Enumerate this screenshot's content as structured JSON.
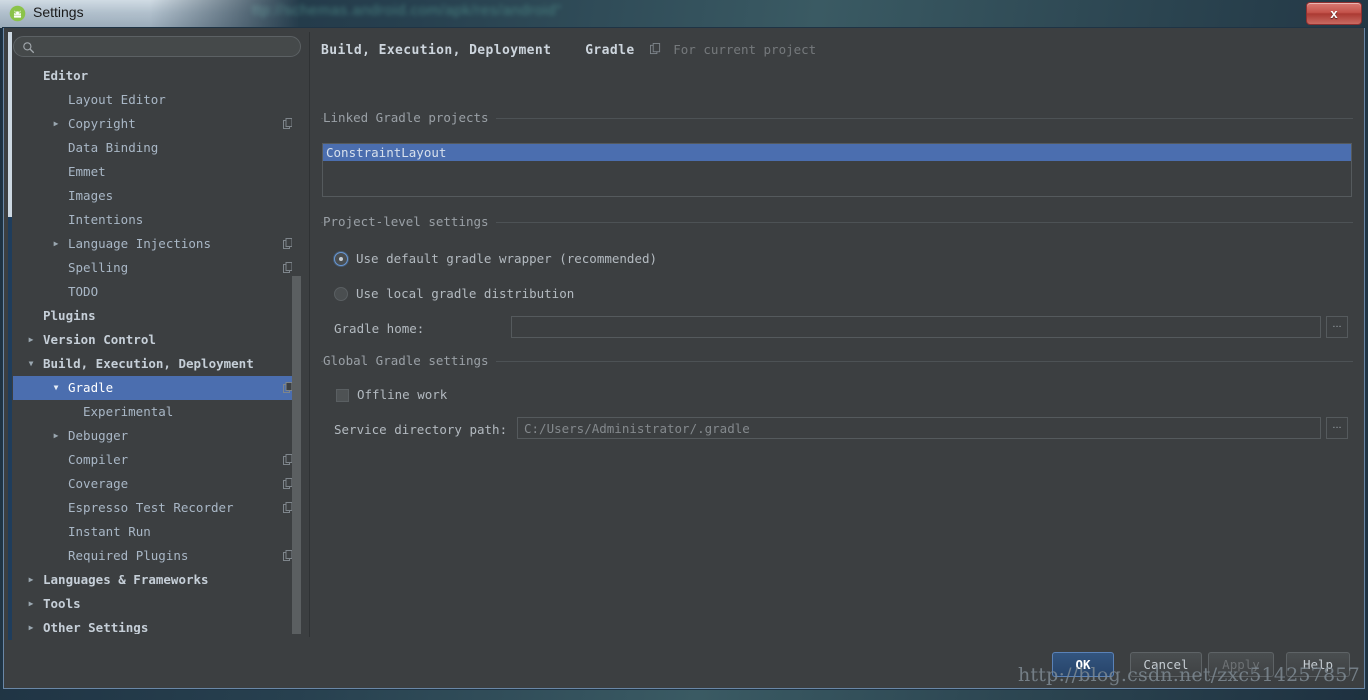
{
  "backdrop": {
    "blurred_text": "ttp://schemas.android.com/apk/res/android\""
  },
  "titlebar": {
    "title": "Settings",
    "app_icon": "android-studio-icon",
    "close_label": "x"
  },
  "search": {
    "value": "",
    "placeholder": "",
    "icon": "search-icon"
  },
  "sidebar": {
    "items": [
      {
        "label": "Editor",
        "indent": 30,
        "twisty": "",
        "bold": true,
        "selected": false,
        "copy_icon": false
      },
      {
        "label": "Layout Editor",
        "indent": 55,
        "twisty": "",
        "bold": false,
        "selected": false,
        "copy_icon": false
      },
      {
        "label": "Copyright",
        "indent": 55,
        "twisty": "▶",
        "bold": false,
        "selected": false,
        "copy_icon": true
      },
      {
        "label": "Data Binding",
        "indent": 55,
        "twisty": "",
        "bold": false,
        "selected": false,
        "copy_icon": false
      },
      {
        "label": "Emmet",
        "indent": 55,
        "twisty": "",
        "bold": false,
        "selected": false,
        "copy_icon": false
      },
      {
        "label": "Images",
        "indent": 55,
        "twisty": "",
        "bold": false,
        "selected": false,
        "copy_icon": false
      },
      {
        "label": "Intentions",
        "indent": 55,
        "twisty": "",
        "bold": false,
        "selected": false,
        "copy_icon": false
      },
      {
        "label": "Language Injections",
        "indent": 55,
        "twisty": "▶",
        "bold": false,
        "selected": false,
        "copy_icon": true
      },
      {
        "label": "Spelling",
        "indent": 55,
        "twisty": "",
        "bold": false,
        "selected": false,
        "copy_icon": true
      },
      {
        "label": "TODO",
        "indent": 55,
        "twisty": "",
        "bold": false,
        "selected": false,
        "copy_icon": false
      },
      {
        "label": "Plugins",
        "indent": 30,
        "twisty": "",
        "bold": true,
        "selected": false,
        "copy_icon": false
      },
      {
        "label": "Version Control",
        "indent": 30,
        "twisty": "▶",
        "bold": true,
        "selected": false,
        "copy_icon": false
      },
      {
        "label": "Build, Execution, Deployment",
        "indent": 30,
        "twisty": "▼",
        "bold": true,
        "selected": false,
        "copy_icon": false
      },
      {
        "label": "Gradle",
        "indent": 55,
        "twisty": "▼",
        "bold": false,
        "selected": true,
        "copy_icon": true
      },
      {
        "label": "Experimental",
        "indent": 70,
        "twisty": "",
        "bold": false,
        "selected": false,
        "copy_icon": false
      },
      {
        "label": "Debugger",
        "indent": 55,
        "twisty": "▶",
        "bold": false,
        "selected": false,
        "copy_icon": false
      },
      {
        "label": "Compiler",
        "indent": 55,
        "twisty": "",
        "bold": false,
        "selected": false,
        "copy_icon": true
      },
      {
        "label": "Coverage",
        "indent": 55,
        "twisty": "",
        "bold": false,
        "selected": false,
        "copy_icon": true
      },
      {
        "label": "Espresso Test Recorder",
        "indent": 55,
        "twisty": "",
        "bold": false,
        "selected": false,
        "copy_icon": true
      },
      {
        "label": "Instant Run",
        "indent": 55,
        "twisty": "",
        "bold": false,
        "selected": false,
        "copy_icon": false
      },
      {
        "label": "Required Plugins",
        "indent": 55,
        "twisty": "",
        "bold": false,
        "selected": false,
        "copy_icon": true
      },
      {
        "label": "Languages & Frameworks",
        "indent": 30,
        "twisty": "▶",
        "bold": true,
        "selected": false,
        "copy_icon": false
      },
      {
        "label": "Tools",
        "indent": 30,
        "twisty": "▶",
        "bold": true,
        "selected": false,
        "copy_icon": false
      },
      {
        "label": "Other Settings",
        "indent": 30,
        "twisty": "▶",
        "bold": true,
        "selected": false,
        "copy_icon": false
      }
    ]
  },
  "breadcrumb": {
    "main": "Build, Execution, Deployment",
    "sub": "Gradle",
    "note": "For current project",
    "note_icon": "project-scope-icon"
  },
  "sections": {
    "linked_projects": {
      "title": "Linked Gradle projects",
      "items": [
        {
          "label": "ConstraintLayout",
          "selected": true
        }
      ]
    },
    "project_level": {
      "title": "Project-level settings",
      "radios": [
        {
          "label": "Use default gradle wrapper (recommended)",
          "checked": true
        },
        {
          "label": "Use local gradle distribution",
          "checked": false
        }
      ],
      "gradle_home": {
        "label": "Gradle home:",
        "value": "",
        "placeholder": "",
        "browse_label": "..."
      }
    },
    "global_settings": {
      "title": "Global Gradle settings",
      "offline": {
        "label": "Offline work",
        "checked": false
      },
      "service_dir": {
        "label": "Service directory path:",
        "value": "C:/Users/Administrator/.gradle",
        "placeholder": "",
        "browse_label": "..."
      }
    }
  },
  "footer": {
    "buttons": {
      "ok": "OK",
      "cancel": "Cancel",
      "apply": "Apply",
      "help": "Help"
    }
  },
  "watermark": {
    "text": "http://blog.csdn.net/zxc514257857"
  },
  "colors": {
    "panel_bg": "#3c3f41",
    "selection_blue": "#4b6eaf",
    "text_primary": "#b3bac0",
    "text_muted": "#84898d",
    "ok_button_blue": "#33557f"
  }
}
